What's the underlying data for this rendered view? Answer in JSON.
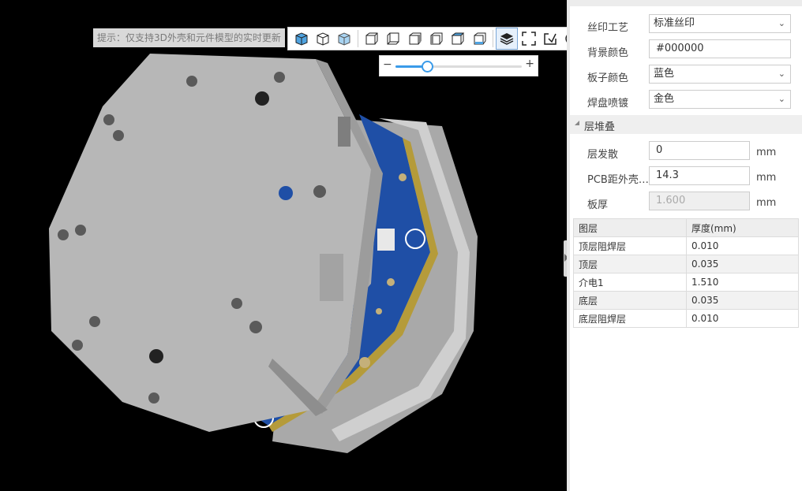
{
  "viewer": {
    "hint": "提示：仅支持3D外壳和元件模型的实时更新",
    "toolbar_icons": [
      "solid-cube-icon",
      "wire-cube-icon",
      "transparent-cube-icon",
      "view-front-icon",
      "view-back-icon",
      "view-left-icon",
      "view-right-icon",
      "view-top-icon",
      "view-bottom-icon",
      "layers-icon",
      "fullscreen-icon",
      "screenshot-icon",
      "reset-view-icon"
    ],
    "zoom": {
      "minus": "−",
      "plus": "+",
      "level": 0.25
    }
  },
  "panel": {
    "silkscreen_process": {
      "label": "丝印工艺",
      "value": "标准丝印"
    },
    "background_color": {
      "label": "背景颜色",
      "value": "#000000"
    },
    "board_color": {
      "label": "板子颜色",
      "value": "蓝色"
    },
    "pad_plating": {
      "label": "焊盘喷镀",
      "value": "金色"
    },
    "stackup_section": "层堆叠",
    "layer_spread": {
      "label": "层发散",
      "value": "0",
      "unit": "mm"
    },
    "pcb_to_shell": {
      "label": "PCB距外壳…",
      "value": "14.3",
      "unit": "mm"
    },
    "board_thickness": {
      "label": "板厚",
      "value": "1.600",
      "unit": "mm"
    },
    "layers_table": {
      "headers": [
        "图层",
        "厚度(mm)"
      ],
      "rows": [
        [
          "顶层阻焊层",
          "0.010"
        ],
        [
          "顶层",
          "0.035"
        ],
        [
          "介电1",
          "1.510"
        ],
        [
          "底层",
          "0.035"
        ],
        [
          "底层阻焊层",
          "0.010"
        ]
      ]
    }
  },
  "colors": {
    "accent": "#3a9be9",
    "pcb": "#1f4fa6",
    "shell": "#b4b4b4"
  }
}
